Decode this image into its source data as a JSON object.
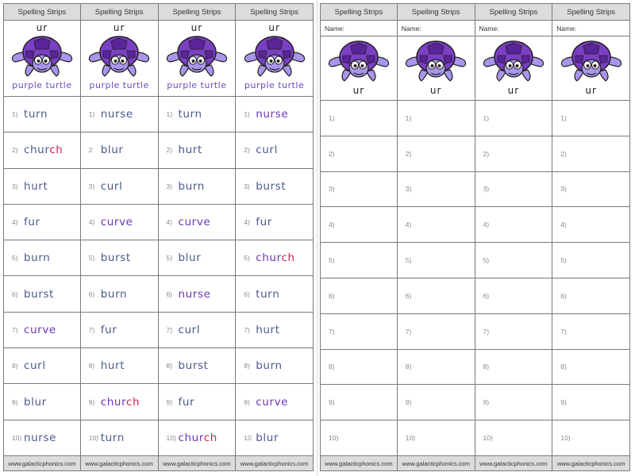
{
  "footer": "www.galacticphonics.com",
  "left": {
    "strips": [
      {
        "header": "Spelling Strips",
        "sound": "ur",
        "caption": "purple turtle",
        "words": [
          {
            "num": "1)",
            "parts": [
              {
                "t": "turn"
              }
            ]
          },
          {
            "num": "2)",
            "parts": [
              {
                "t": "chur"
              },
              {
                "t": "ch",
                "hl": true
              }
            ]
          },
          {
            "num": "3)",
            "parts": [
              {
                "t": "hurt"
              }
            ]
          },
          {
            "num": "4)",
            "parts": [
              {
                "t": "fur"
              }
            ]
          },
          {
            "num": "5)",
            "parts": [
              {
                "t": "burn"
              }
            ]
          },
          {
            "num": "6)",
            "parts": [
              {
                "t": "burst"
              }
            ]
          },
          {
            "num": "7)",
            "parts": [
              {
                "t": "curve",
                "purple": true
              }
            ]
          },
          {
            "num": "8)",
            "parts": [
              {
                "t": "curl"
              }
            ]
          },
          {
            "num": "9)",
            "parts": [
              {
                "t": "blur"
              }
            ]
          },
          {
            "num": "10)",
            "parts": [
              {
                "t": "nurse"
              }
            ]
          }
        ]
      },
      {
        "header": "Spelling Strips",
        "sound": "ur",
        "caption": "purple turtle",
        "words": [
          {
            "num": "1)",
            "parts": [
              {
                "t": "nurse"
              }
            ]
          },
          {
            "num": "2",
            "parts": [
              {
                "t": "blur"
              }
            ]
          },
          {
            "num": "3)",
            "parts": [
              {
                "t": "curl"
              }
            ]
          },
          {
            "num": "4)",
            "parts": [
              {
                "t": "curve",
                "purple": true
              }
            ]
          },
          {
            "num": "5)",
            "parts": [
              {
                "t": "burst"
              }
            ]
          },
          {
            "num": "6)",
            "parts": [
              {
                "t": "burn"
              }
            ]
          },
          {
            "num": "7)",
            "parts": [
              {
                "t": "fur"
              }
            ]
          },
          {
            "num": "8)",
            "parts": [
              {
                "t": "hurt"
              }
            ]
          },
          {
            "num": "9)",
            "parts": [
              {
                "t": "chur",
                "purple": true
              },
              {
                "t": "ch",
                "hl": true
              }
            ]
          },
          {
            "num": "10)",
            "parts": [
              {
                "t": "turn"
              }
            ]
          }
        ]
      },
      {
        "header": "Spelling Strips",
        "sound": "ur",
        "caption": "purple turtle",
        "words": [
          {
            "num": "1)",
            "parts": [
              {
                "t": "turn"
              }
            ]
          },
          {
            "num": "2)",
            "parts": [
              {
                "t": "hurt"
              }
            ]
          },
          {
            "num": "3)",
            "parts": [
              {
                "t": "burn"
              }
            ]
          },
          {
            "num": "4)",
            "parts": [
              {
                "t": "curve",
                "purple": true
              }
            ]
          },
          {
            "num": "5)",
            "parts": [
              {
                "t": "blur"
              }
            ]
          },
          {
            "num": "6)",
            "parts": [
              {
                "t": "nurse",
                "purple": true
              }
            ]
          },
          {
            "num": "7)",
            "parts": [
              {
                "t": "curl"
              }
            ]
          },
          {
            "num": "8)",
            "parts": [
              {
                "t": "burst"
              }
            ]
          },
          {
            "num": "9)",
            "parts": [
              {
                "t": "fur"
              }
            ]
          },
          {
            "num": "10)",
            "parts": [
              {
                "t": "chur",
                "purple": true
              },
              {
                "t": "ch",
                "hl": true
              }
            ]
          }
        ]
      },
      {
        "header": "Spelling Strips",
        "sound": "ur",
        "caption": "purple turtle",
        "words": [
          {
            "num": "1)",
            "parts": [
              {
                "t": "nurse",
                "purple": true
              }
            ]
          },
          {
            "num": "2)",
            "parts": [
              {
                "t": "curl"
              }
            ]
          },
          {
            "num": "3)",
            "parts": [
              {
                "t": "burst"
              }
            ]
          },
          {
            "num": "4)",
            "parts": [
              {
                "t": "fur"
              }
            ]
          },
          {
            "num": "5)",
            "parts": [
              {
                "t": "chur",
                "purple": true
              },
              {
                "t": "ch",
                "hl": true
              }
            ]
          },
          {
            "num": "6)",
            "parts": [
              {
                "t": "turn"
              }
            ]
          },
          {
            "num": "7)",
            "parts": [
              {
                "t": "hurt"
              }
            ]
          },
          {
            "num": "8)",
            "parts": [
              {
                "t": "burn"
              }
            ]
          },
          {
            "num": "9)",
            "parts": [
              {
                "t": "curve",
                "purple": true
              }
            ]
          },
          {
            "num": "10",
            "parts": [
              {
                "t": "blur"
              }
            ]
          }
        ]
      }
    ]
  },
  "right": {
    "header": "Spelling Strips",
    "name_label": "Name:",
    "sound": "ur",
    "numbers": [
      "1)",
      "2)",
      "3)",
      "4)",
      "5)",
      "6)",
      "7)",
      "8)",
      "9)",
      "10)"
    ],
    "strip_count": 4
  },
  "colors": {
    "word": "#4a5a8c",
    "highlight": "#d11f4a",
    "accent_purple": "#6b35b8",
    "turtle_shell": "#7b3fc4",
    "turtle_skin": "#a995ec"
  }
}
